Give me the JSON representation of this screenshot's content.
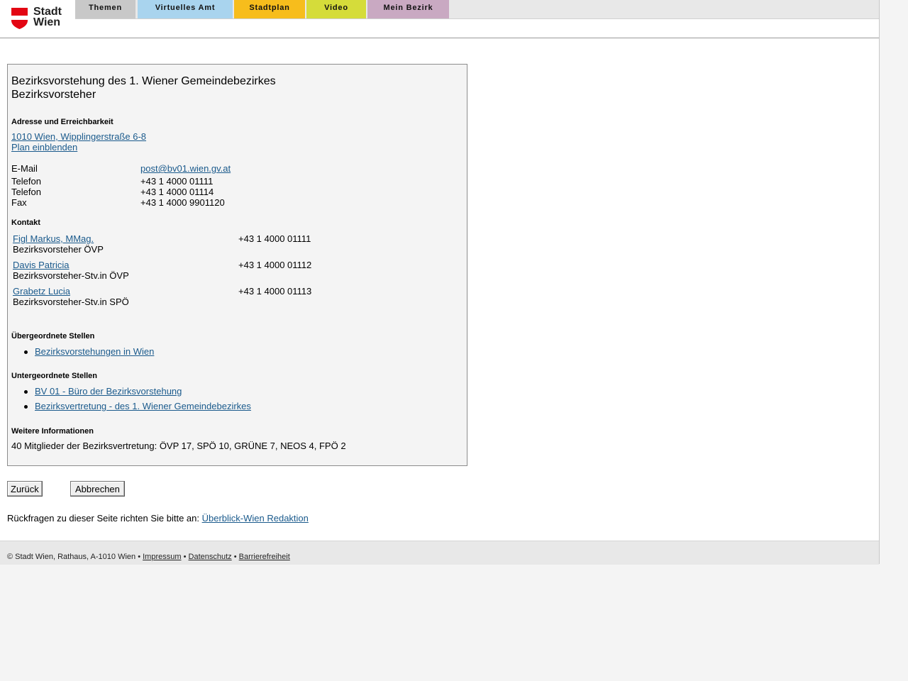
{
  "logo": {
    "line1": "Stadt",
    "line2": "Wien"
  },
  "colors": {
    "themen": "#c8c8c8",
    "virtuelles_amt": "#a9d4ee",
    "stadtplan": "#f7bd1c",
    "video": "#d5dc3a",
    "mein_bezirk": "#c9a9c2",
    "link": "#1a5a8c",
    "shield": "#e30613"
  },
  "nav": [
    "Themen",
    "Virtuelles Amt",
    "Stadtplan",
    "Video",
    "Mein Bezirk"
  ],
  "main": {
    "title_line1": "Bezirksvorstehung des 1. Wiener Gemeindebezirkes",
    "title_line2": "Bezirksvorsteher",
    "address_heading": "Adresse und Erreichbarkeit",
    "address_link": "1010 Wien, Wipplingerstraße 6-8",
    "map_link": "Plan einblenden",
    "contacts": [
      {
        "label": "E-Mail",
        "value": "post@bv01.wien.gv.at"
      },
      {
        "label": "Telefon",
        "value": "+43 1 4000 01111"
      },
      {
        "label": "Telefon",
        "value": "+43 1 4000 01114"
      },
      {
        "label": "Fax",
        "value": "+43 1 4000 9901120"
      }
    ],
    "kontakt_heading": "Kontakt",
    "persons": [
      {
        "name": "Figl Markus, MMag.",
        "role": "Bezirksvorsteher ÖVP",
        "phone": "+43 1 4000 01111"
      },
      {
        "name": "Davis Patricia",
        "role": "Bezirksvorsteher-Stv.in ÖVP",
        "phone": "+43 1 4000 01112"
      },
      {
        "name": "Grabetz Lucia",
        "role": "Bezirksvorsteher-Stv.in SPÖ",
        "phone": "+43 1 4000 01113"
      }
    ],
    "upper_heading": "Übergeordnete Stellen",
    "upper_links": [
      "Bezirksvorstehungen in Wien"
    ],
    "lower_heading": "Untergeordnete Stellen",
    "lower_links": [
      "BV 01 - Büro der Bezirksvorstehung",
      "Bezirksvertretung - des 1. Wiener Gemeindebezirkes"
    ],
    "info_heading": "Weitere Informationen",
    "info_text": "40 Mitglieder der Bezirksvertretung: ÖVP 17, SPÖ 10, GRÜNE 7, NEOS 4, FPÖ 2"
  },
  "buttons": {
    "back": "Zurück",
    "cancel": "Abbrechen"
  },
  "feedback": {
    "text": "Rückfragen zu dieser Seite richten Sie bitte an:",
    "link": "Überblick-Wien Redaktion"
  },
  "footer": {
    "copyright": "© Stadt Wien, Rathaus, A-1010 Wien",
    "sep": "•",
    "links": [
      "Impressum",
      "Datenschutz",
      "Barrierefreiheit"
    ]
  }
}
